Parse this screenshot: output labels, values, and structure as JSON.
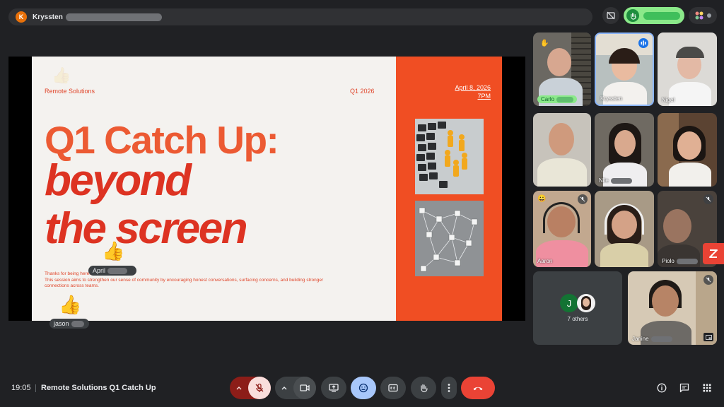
{
  "topbar": {
    "presenter_initial": "K",
    "presenter_name": "Kryssten"
  },
  "slide": {
    "company": "Remote Solutions",
    "quarter": "Q1 2026",
    "date": "April 8, 2026",
    "time": "7PM",
    "title_line1": "Q1 Catch Up:",
    "title_line2": "beyond",
    "title_line3": "the screen",
    "body_line1": "Thanks for being here!",
    "body_line2": "This session aims to strengthen our sense of community by encouraging honest conversations, surfacing concerns, and building stronger",
    "body_line3": "connections across teams."
  },
  "reactions": [
    {
      "emoji": "👍",
      "name": "April"
    },
    {
      "emoji": "👍",
      "name": "jason"
    }
  ],
  "participants": [
    {
      "name": "Carlo",
      "hand": "✋"
    },
    {
      "name": "Kryssten"
    },
    {
      "name": "Nigel"
    },
    {
      "name": ""
    },
    {
      "name": "Nile"
    },
    {
      "name": ""
    },
    {
      "name": "Aaron",
      "emoji": "😀"
    },
    {
      "name": ""
    },
    {
      "name": "Piolo"
    },
    {
      "name": "Janine"
    }
  ],
  "others": {
    "initial": "J",
    "label": "7 others"
  },
  "bottombar": {
    "time": "19:05",
    "meeting_title": "Remote Solutions Q1 Catch Up"
  },
  "colors": {
    "background": "#202124",
    "slide_orange": "#f04e23",
    "title_red": "#dd3322",
    "raise_hand_green": "#8be98a",
    "end_call_red": "#ea4335",
    "reaction_blue": "#a8c7fa"
  }
}
